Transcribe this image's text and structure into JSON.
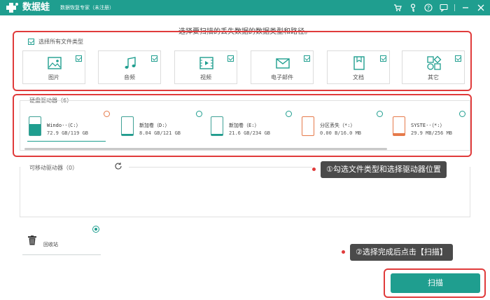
{
  "app": {
    "name": "数据蛙",
    "subtitle": "数据恢复专家（未注册）",
    "toolbar_icons": [
      "cart-icon",
      "key-icon",
      "help-icon",
      "feedback-icon",
      "minimize-icon",
      "close-icon"
    ]
  },
  "instruction": "选择要扫描的丢失数据的数据类型和路径。",
  "file_types": {
    "select_all_label": "选择所有文件类型",
    "select_all_checked": true,
    "items": [
      {
        "label": "图片",
        "icon": "image-icon",
        "checked": true
      },
      {
        "label": "音频",
        "icon": "music-icon",
        "checked": true
      },
      {
        "label": "视频",
        "icon": "video-icon",
        "checked": true
      },
      {
        "label": "电子邮件",
        "icon": "email-icon",
        "checked": true
      },
      {
        "label": "文档",
        "icon": "document-icon",
        "checked": true
      },
      {
        "label": "其它",
        "icon": "other-icon",
        "checked": true
      }
    ]
  },
  "disks": {
    "header": "硬盘驱动器（6）",
    "items": [
      {
        "name": "Windo··（C:）",
        "size": "72.9 GB/119 GB",
        "used_fraction": 0.61,
        "radio": "warn"
      },
      {
        "name": "新加卷（D:）",
        "size": "8.04 GB/121 GB",
        "used_fraction": 0.07,
        "radio": "normal"
      },
      {
        "name": "新加卷（E:）",
        "size": "21.6 GB/234 GB",
        "used_fraction": 0.09,
        "radio": "normal"
      },
      {
        "name": "分区丢失（*:）",
        "size": "0.00  B/16.0 MB",
        "used_fraction": 0.0,
        "radio": "normal"
      },
      {
        "name": "SYSTE··（*:）",
        "size": "29.9 MB/256 MB",
        "used_fraction": 0.12,
        "radio": "normal"
      }
    ]
  },
  "removable": {
    "header": "可移动驱动器（0）"
  },
  "recycle": {
    "label": "回收站",
    "selected": true
  },
  "callouts": {
    "step1": "①勾选文件类型和选择驱动器位置",
    "step2": "②选择完成后点击【扫描】"
  },
  "scan_button": "扫描",
  "colors": {
    "accent": "#1f9e8f",
    "highlight": "#e03b3b"
  }
}
